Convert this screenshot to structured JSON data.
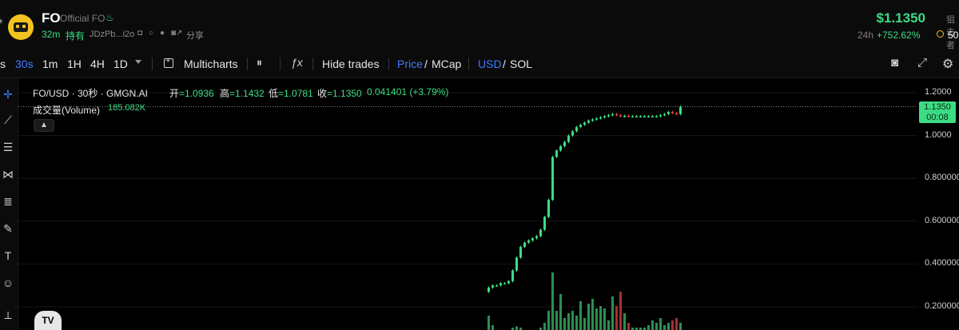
{
  "header": {
    "ticker": "FO",
    "official_label": "Official FO",
    "age": "32m",
    "holders_label": "持有",
    "address": "JDzPb...i2o",
    "share_label": "分享",
    "price": "$1.1350",
    "change_period": "24h",
    "change_pct": "+752.62%",
    "snipe_label": "狙击者",
    "snipe_value": "50",
    "icons": [
      "star-icon",
      "logo-icon",
      "fire-icon",
      "copy-icon",
      "search-icon",
      "twitter-icon",
      "external-link-icon"
    ]
  },
  "toolbar": {
    "intervals": [
      "s",
      "30s",
      "1m",
      "1H",
      "4H",
      "1D"
    ],
    "active_interval": "30s",
    "multicharts_label": "Multicharts",
    "hide_trades_label": "Hide trades",
    "price_label": "Price",
    "mcap_label": "MCap",
    "usd_label": "USD",
    "sol_label": "SOL",
    "slash": "/"
  },
  "chart": {
    "symbol_line": "FO/USD · 30秒 · GMGN.AI",
    "open_label": "开",
    "open_value": "=1.0936",
    "high_label": "高",
    "high_value": "=1.1432",
    "low_label": "低",
    "low_value": "=1.0781",
    "close_label": "收",
    "close_value": "=1.1350",
    "change_value": "0.041401 (+3.79%)",
    "volume_label": "成交量(Volume)",
    "volume_value": "185.082K",
    "last_price_tag": "1.1350",
    "countdown_tag": "00:08",
    "up_color": "#3ddc84",
    "down_color": "#e04545"
  },
  "chart_data": {
    "type": "candlestick",
    "y_ticks": [
      "1.2000",
      "1.0000",
      "0.800000",
      "0.600000",
      "0.400000",
      "0.200000"
    ],
    "ylim": [
      0.1,
      1.23
    ],
    "last_price": 1.135,
    "candles_close": [
      0.29,
      0.3,
      0.3,
      0.31,
      0.31,
      0.32,
      0.37,
      0.43,
      0.48,
      0.5,
      0.51,
      0.52,
      0.53,
      0.56,
      0.62,
      0.7,
      0.9,
      0.93,
      0.95,
      0.97,
      1.0,
      1.02,
      1.04,
      1.05,
      1.06,
      1.07,
      1.075,
      1.08,
      1.085,
      1.09,
      1.095,
      1.1,
      1.095,
      1.09,
      1.092,
      1.09,
      1.09,
      1.09,
      1.09,
      1.09,
      1.09,
      1.09,
      1.09,
      1.095,
      1.1,
      1.11,
      1.105,
      1.1,
      1.135
    ],
    "volume": [
      0.06,
      0.02,
      0.0,
      0.0,
      0.0,
      0.0,
      0.01,
      0.015,
      0.01,
      0.0,
      0.0,
      0.0,
      0.0,
      0.01,
      0.03,
      0.08,
      0.24,
      0.08,
      0.15,
      0.05,
      0.07,
      0.08,
      0.06,
      0.12,
      0.05,
      0.11,
      0.13,
      0.09,
      0.1,
      0.09,
      0.04,
      0.14,
      0.1,
      0.16,
      0.07,
      0.03,
      0.01,
      0.01,
      0.01,
      0.01,
      0.02,
      0.04,
      0.03,
      0.05,
      0.02,
      0.03,
      0.04,
      0.05,
      0.03
    ]
  }
}
